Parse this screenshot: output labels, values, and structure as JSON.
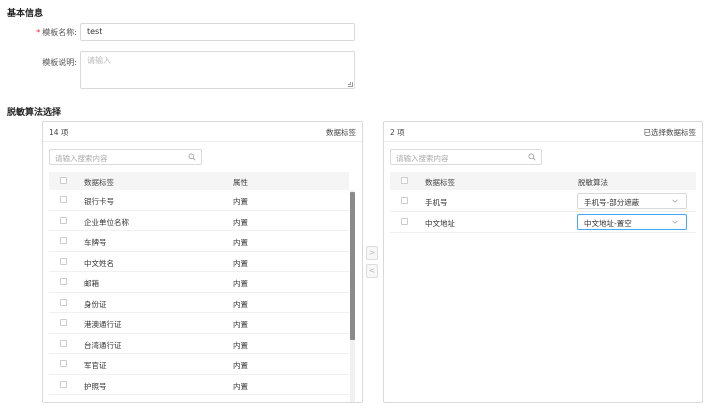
{
  "basic_info": {
    "title": "基本信息",
    "template_name_label": "模板名称:",
    "template_name_value": "test",
    "template_desc_label": "模板说明:",
    "template_desc_placeholder": "请输入"
  },
  "algo_section": {
    "title": "脱敏算法选择"
  },
  "left_panel": {
    "count": "14 项",
    "title": "数据标签",
    "search_placeholder": "请输入搜索内容",
    "col_tag": "数据标签",
    "col_attr": "属性",
    "rows": [
      {
        "tag": "银行卡号",
        "attr": "内置"
      },
      {
        "tag": "企业单位名称",
        "attr": "内置"
      },
      {
        "tag": "车牌号",
        "attr": "内置"
      },
      {
        "tag": "中文姓名",
        "attr": "内置"
      },
      {
        "tag": "邮箱",
        "attr": "内置"
      },
      {
        "tag": "身份证",
        "attr": "内置"
      },
      {
        "tag": "港澳通行证",
        "attr": "内置"
      },
      {
        "tag": "台湾通行证",
        "attr": "内置"
      },
      {
        "tag": "军官证",
        "attr": "内置"
      },
      {
        "tag": "护照号",
        "attr": "内置"
      }
    ]
  },
  "transfer": {
    "to_right": ">",
    "to_left": "<"
  },
  "right_panel": {
    "count": "2 项",
    "title": "已选择数据标签",
    "search_placeholder": "请输入搜索内容",
    "col_tag": "数据标签",
    "col_algo": "脱敏算法",
    "rows": [
      {
        "tag": "手机号",
        "algo": "手机号-部分遮蔽"
      },
      {
        "tag": "中文地址",
        "algo": "中文地址-置空"
      }
    ]
  },
  "colors": {
    "required": "#f5222d",
    "focus_border": "#40a9ff",
    "scroll_thumb": "#8a8a8a"
  }
}
